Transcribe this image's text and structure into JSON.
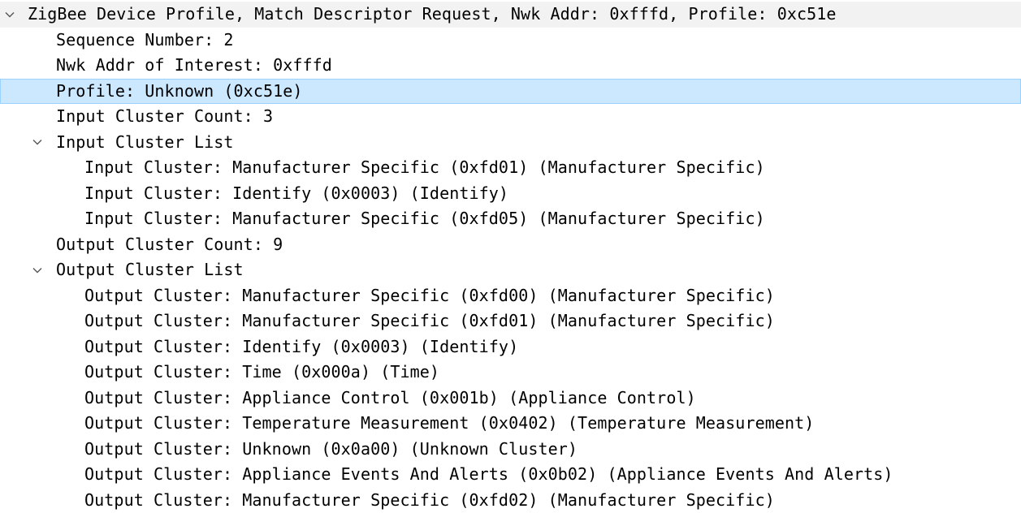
{
  "tree": {
    "root": {
      "label": "ZigBee Device Profile, Match Descriptor Request, Nwk Addr: 0xfffd, Profile: 0xc51e",
      "expanded": true,
      "icon": "chevron-down-icon"
    },
    "fields": {
      "sequence_number": "Sequence Number: 2",
      "nwk_addr": "Nwk Addr of Interest: 0xfffd",
      "profile": "Profile: Unknown (0xc51e)",
      "input_cluster_count": "Input Cluster Count: 3",
      "output_cluster_count": "Output Cluster Count: 9"
    },
    "input_cluster_list": {
      "label": "Input Cluster List",
      "expanded": true,
      "icon": "chevron-down-icon",
      "items": [
        "Input Cluster: Manufacturer Specific (0xfd01) (Manufacturer Specific)",
        "Input Cluster: Identify (0x0003) (Identify)",
        "Input Cluster: Manufacturer Specific (0xfd05) (Manufacturer Specific)"
      ]
    },
    "output_cluster_list": {
      "label": "Output Cluster List",
      "expanded": true,
      "icon": "chevron-down-icon",
      "items": [
        "Output Cluster: Manufacturer Specific (0xfd00) (Manufacturer Specific)",
        "Output Cluster: Manufacturer Specific (0xfd01) (Manufacturer Specific)",
        "Output Cluster: Identify (0x0003) (Identify)",
        "Output Cluster: Time (0x000a) (Time)",
        "Output Cluster: Appliance Control (0x001b) (Appliance Control)",
        "Output Cluster: Temperature Measurement (0x0402) (Temperature Measurement)",
        "Output Cluster: Unknown (0x0a00) (Unknown Cluster)",
        "Output Cluster: Appliance Events And Alerts (0x0b02) (Appliance Events And Alerts)",
        "Output Cluster: Manufacturer Specific (0xfd02) (Manufacturer Specific)"
      ]
    },
    "selected_field": "profile",
    "colors": {
      "selection_background": "#cce8ff",
      "selection_border": "#99d1ff",
      "root_background": "#f2f2f2",
      "chevron": "#555555"
    }
  }
}
